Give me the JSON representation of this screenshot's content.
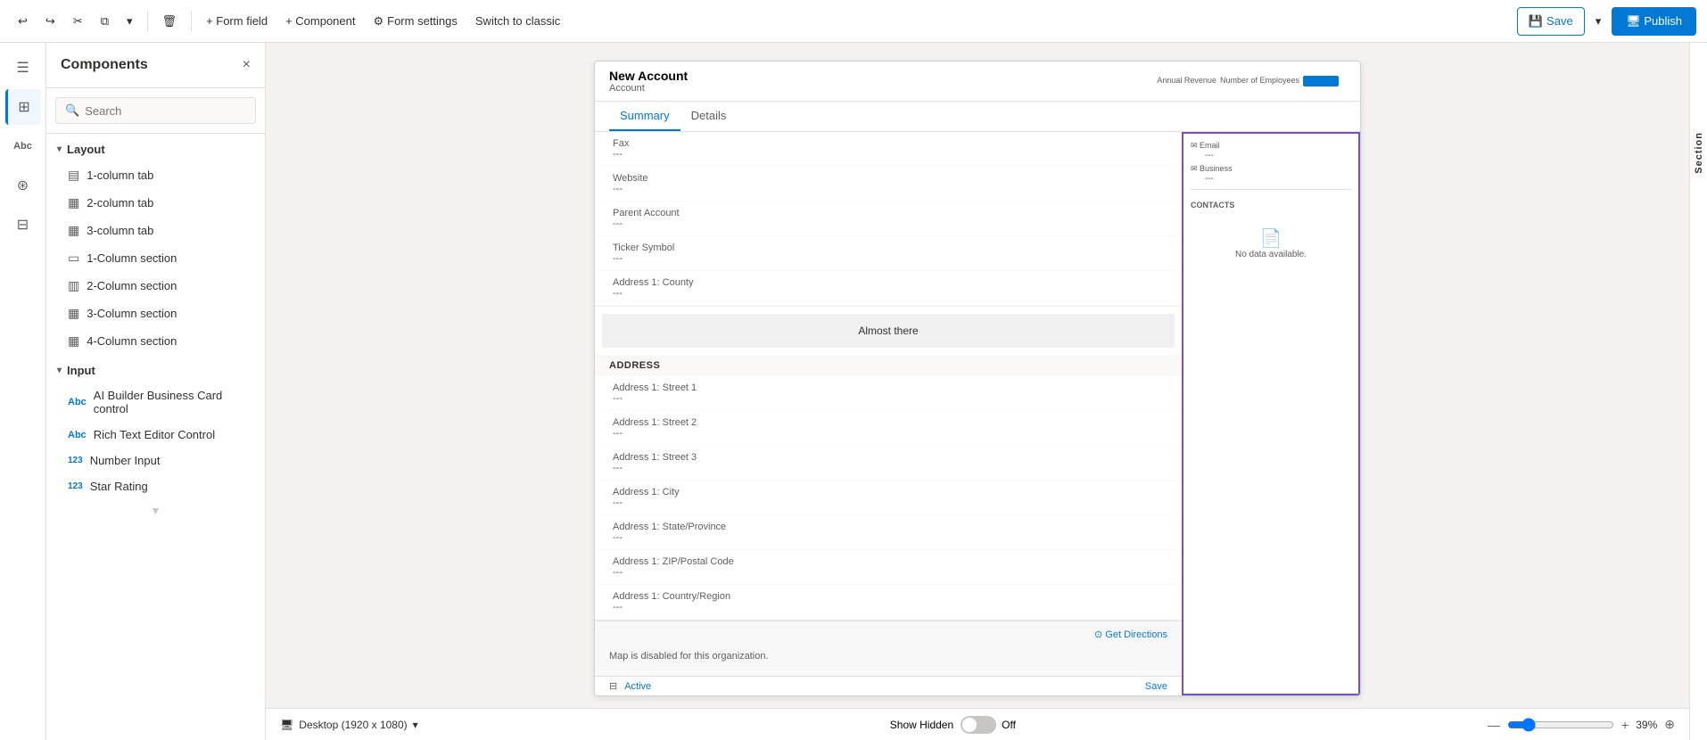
{
  "toolbar": {
    "undo_label": "Undo",
    "redo_label": "Redo",
    "cut_label": "Cut",
    "copy_label": "Copy",
    "delete_label": "Delete",
    "form_field_label": "+ Form field",
    "component_label": "+ Component",
    "form_settings_label": "Form settings",
    "switch_label": "Switch to classic",
    "save_label": "Save",
    "publish_label": "Publish"
  },
  "left_nav": {
    "items": [
      {
        "id": "menu",
        "icon": "☰",
        "label": ""
      },
      {
        "id": "components",
        "icon": "⊞",
        "label": "Components",
        "active": true
      },
      {
        "id": "table",
        "icon": "Abc",
        "label": "Table columns"
      },
      {
        "id": "tree",
        "icon": "⟐",
        "label": "Tree view"
      },
      {
        "id": "libraries",
        "icon": "⊟",
        "label": "Form libraries"
      }
    ]
  },
  "sidebar": {
    "title": "Components",
    "close_label": "×",
    "search": {
      "placeholder": "Search",
      "value": ""
    },
    "sections": [
      {
        "id": "layout",
        "label": "Layout",
        "expanded": true,
        "items": [
          {
            "id": "1col-tab",
            "icon": "▤",
            "label": "1-column tab"
          },
          {
            "id": "2col-tab",
            "icon": "▦",
            "label": "2-column tab"
          },
          {
            "id": "3col-tab",
            "icon": "▦",
            "label": "3-column tab"
          },
          {
            "id": "1col-section",
            "icon": "▭",
            "label": "1-Column section"
          },
          {
            "id": "2col-section",
            "icon": "▥",
            "label": "2-Column section"
          },
          {
            "id": "3col-section",
            "icon": "▦",
            "label": "3-Column section"
          },
          {
            "id": "4col-section",
            "icon": "▦",
            "label": "4-Column section"
          }
        ]
      },
      {
        "id": "input",
        "label": "Input",
        "expanded": true,
        "items": [
          {
            "id": "ai-builder",
            "icon": "Abc",
            "label": "AI Builder Business Card control"
          },
          {
            "id": "rich-text",
            "icon": "Abc",
            "label": "Rich Text Editor Control"
          },
          {
            "id": "number-input",
            "icon": "123",
            "label": "Number Input"
          },
          {
            "id": "star-rating",
            "icon": "123",
            "label": "Star Rating"
          }
        ]
      }
    ]
  },
  "form_preview": {
    "title": "New Account",
    "subtitle": "Account",
    "tabs": [
      {
        "id": "summary",
        "label": "Summary",
        "active": true
      },
      {
        "id": "details",
        "label": "Details",
        "active": false
      }
    ],
    "banner": "Almost there",
    "sections": [
      {
        "id": "contact-info",
        "fields": [
          {
            "label": "Fax",
            "value": "---"
          },
          {
            "label": "Website",
            "value": "---"
          },
          {
            "label": "Parent Account",
            "value": "---"
          },
          {
            "label": "Ticker Symbol",
            "value": "---"
          },
          {
            "label": "Address 1: County",
            "value": "---"
          }
        ]
      },
      {
        "id": "address",
        "title": "ADDRESS",
        "fields": [
          {
            "label": "Address 1: Street 1",
            "value": "---"
          },
          {
            "label": "Address 1: Street 2",
            "value": "---"
          },
          {
            "label": "Address 1: Street 3",
            "value": "---"
          },
          {
            "label": "Address 1: City",
            "value": "---"
          },
          {
            "label": "Address 1: State/Province",
            "value": "---"
          },
          {
            "label": "Address 1: ZIP/Postal Code",
            "value": "---"
          },
          {
            "label": "Address 1: Country/Region",
            "value": "---"
          }
        ]
      }
    ],
    "map": {
      "disabled_text": "Map is disabled for this organization.",
      "get_directions": "Get Directions"
    },
    "right_panel": {
      "header_items": [
        {
          "label": "Annual Revenue",
          "value": "---"
        },
        {
          "label": "Number of Employees",
          "value": "---"
        }
      ],
      "contact_types": [
        {
          "type": "Email",
          "value": "---"
        },
        {
          "type": "Business",
          "value": "---"
        }
      ],
      "contacts_section": {
        "label": "CONTACTS",
        "no_data": "No data available."
      }
    },
    "status_bar": {
      "icon": "⊟",
      "status_text": "Active",
      "save_text": "Save"
    }
  },
  "bottom_bar": {
    "device": "Desktop (1920 x 1080)",
    "show_hidden_label": "Show Hidden",
    "toggle_state": "Off",
    "zoom_value": "39%",
    "fit_icon": "⊕"
  },
  "right_collapse": {
    "label": "Section"
  }
}
